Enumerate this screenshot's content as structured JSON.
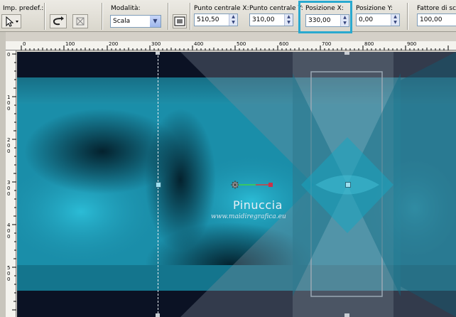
{
  "toolbar": {
    "preset_label": "Imp. predef.:",
    "mode": {
      "label": "Modalità:",
      "value": "Scala"
    },
    "center_x": {
      "label": "Punto centrale X:",
      "value": "510,50"
    },
    "center_y": {
      "label": "Punto centrale Y:",
      "value": "310,00"
    },
    "pos_x": {
      "label": "Posizione X:",
      "value": "330,00"
    },
    "pos_y": {
      "label": "Posizione Y:",
      "value": "0,00"
    },
    "scale": {
      "label": "Fattore di sc",
      "value": "100,00"
    }
  },
  "ruler": {
    "h_ticks": [
      "0",
      "100",
      "200",
      "300",
      "400",
      "500",
      "600",
      "700",
      "800",
      "900"
    ],
    "v_ticks": [
      "0",
      "1 0 0",
      "2 0 0",
      "3 0 0",
      "4 0 0",
      "5 0 0"
    ]
  },
  "watermark": {
    "name": "Pinuccia",
    "url": "www.maidiregrafica.eu"
  },
  "colors": {
    "accent": "#29a9cf",
    "canvas_teal": "#1e9db8"
  }
}
